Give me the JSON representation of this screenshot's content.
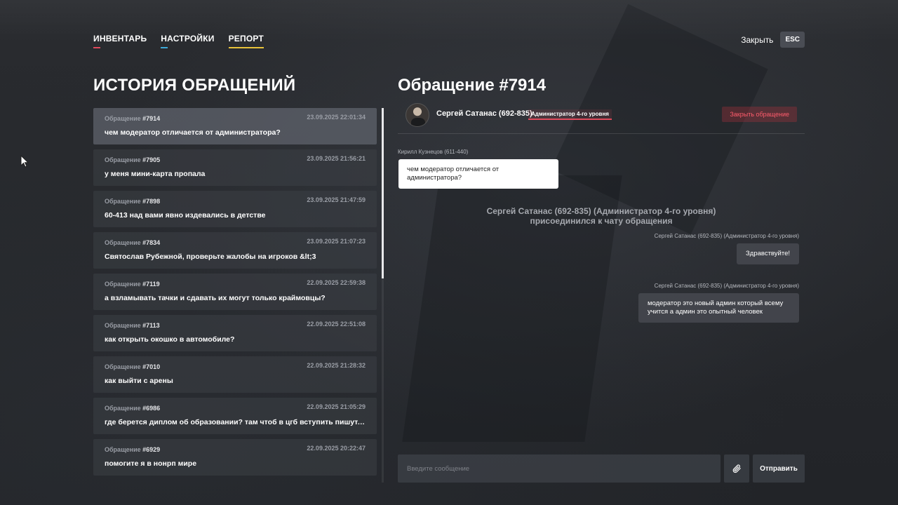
{
  "nav": {
    "items": [
      {
        "label": "ИНВЕНТАРЬ",
        "color": "#e04a5c"
      },
      {
        "label": "НАСТРОЙКИ",
        "color": "#3ea8d8"
      },
      {
        "label": "РЕПОРТ",
        "color": "#e8c23a"
      }
    ],
    "close_label": "Закрыть",
    "esc_label": "ESC"
  },
  "history": {
    "title": "ИСТОРИЯ ОБРАЩЕНИЙ",
    "tickets": [
      {
        "label": "Обращение",
        "num": "#7914",
        "date": "23.09.2025 22:01:34",
        "text": "чем модератор отличается от администратора?"
      },
      {
        "label": "Обращение",
        "num": "#7905",
        "date": "23.09.2025 21:56:21",
        "text": "у меня мини-карта пропала"
      },
      {
        "label": "Обращение",
        "num": "#7898",
        "date": "23.09.2025 21:47:59",
        "text": "60-413 над вами явно издевались в детстве"
      },
      {
        "label": "Обращение",
        "num": "#7834",
        "date": "23.09.2025 21:07:23",
        "text": "Святослав Рубежной, проверьте жалобы на игроков &lt;3"
      },
      {
        "label": "Обращение",
        "num": "#7119",
        "date": "22.09.2025 22:59:38",
        "text": "а взламывать тачки и сдавать их могут только краймовцы?"
      },
      {
        "label": "Обращение",
        "num": "#7113",
        "date": "22.09.2025 22:51:08",
        "text": "как открыть окошко в автомобиле?"
      },
      {
        "label": "Обращение",
        "num": "#7010",
        "date": "22.09.2025 21:28:32",
        "text": "как выйти с арены"
      },
      {
        "label": "Обращение",
        "num": "#6986",
        "date": "22.09.2025 21:05:29",
        "text": "где берется диплом об образовании? там чтоб в цгб вступить пишут, что он н..."
      },
      {
        "label": "Обращение",
        "num": "#6929",
        "date": "22.09.2025 20:22:47",
        "text": "помогите я в нонрп мире"
      }
    ]
  },
  "request": {
    "title": "Обращение #7914",
    "admin_name": "Сергей Сатанас (692-835)",
    "admin_role": "Администратор 4-го уровня",
    "close_request": "Закрыть обращение",
    "user_name": "Кирилл Кузнецов (611-440)",
    "user_message": "чем модератор отличается от администратора?",
    "system_line1": "Сергей Сатанас (692-835) (Администратор 4-го уровня)",
    "system_line2": "присоединился к чату обращения",
    "admin_messages": [
      {
        "author": "Сергей Сатанас (692-835) (Администратор 4-го уровня)",
        "text": "Здравствуйте!"
      },
      {
        "author": "Сергей Сатанас (692-835) (Администратор 4-го уровня)",
        "text": "модератор это новый админ который всему учится а админ это опытный человек"
      }
    ],
    "input_placeholder": "Введите сообщение",
    "send_label": "Отправить",
    "attach_icon": "paperclip-icon"
  }
}
